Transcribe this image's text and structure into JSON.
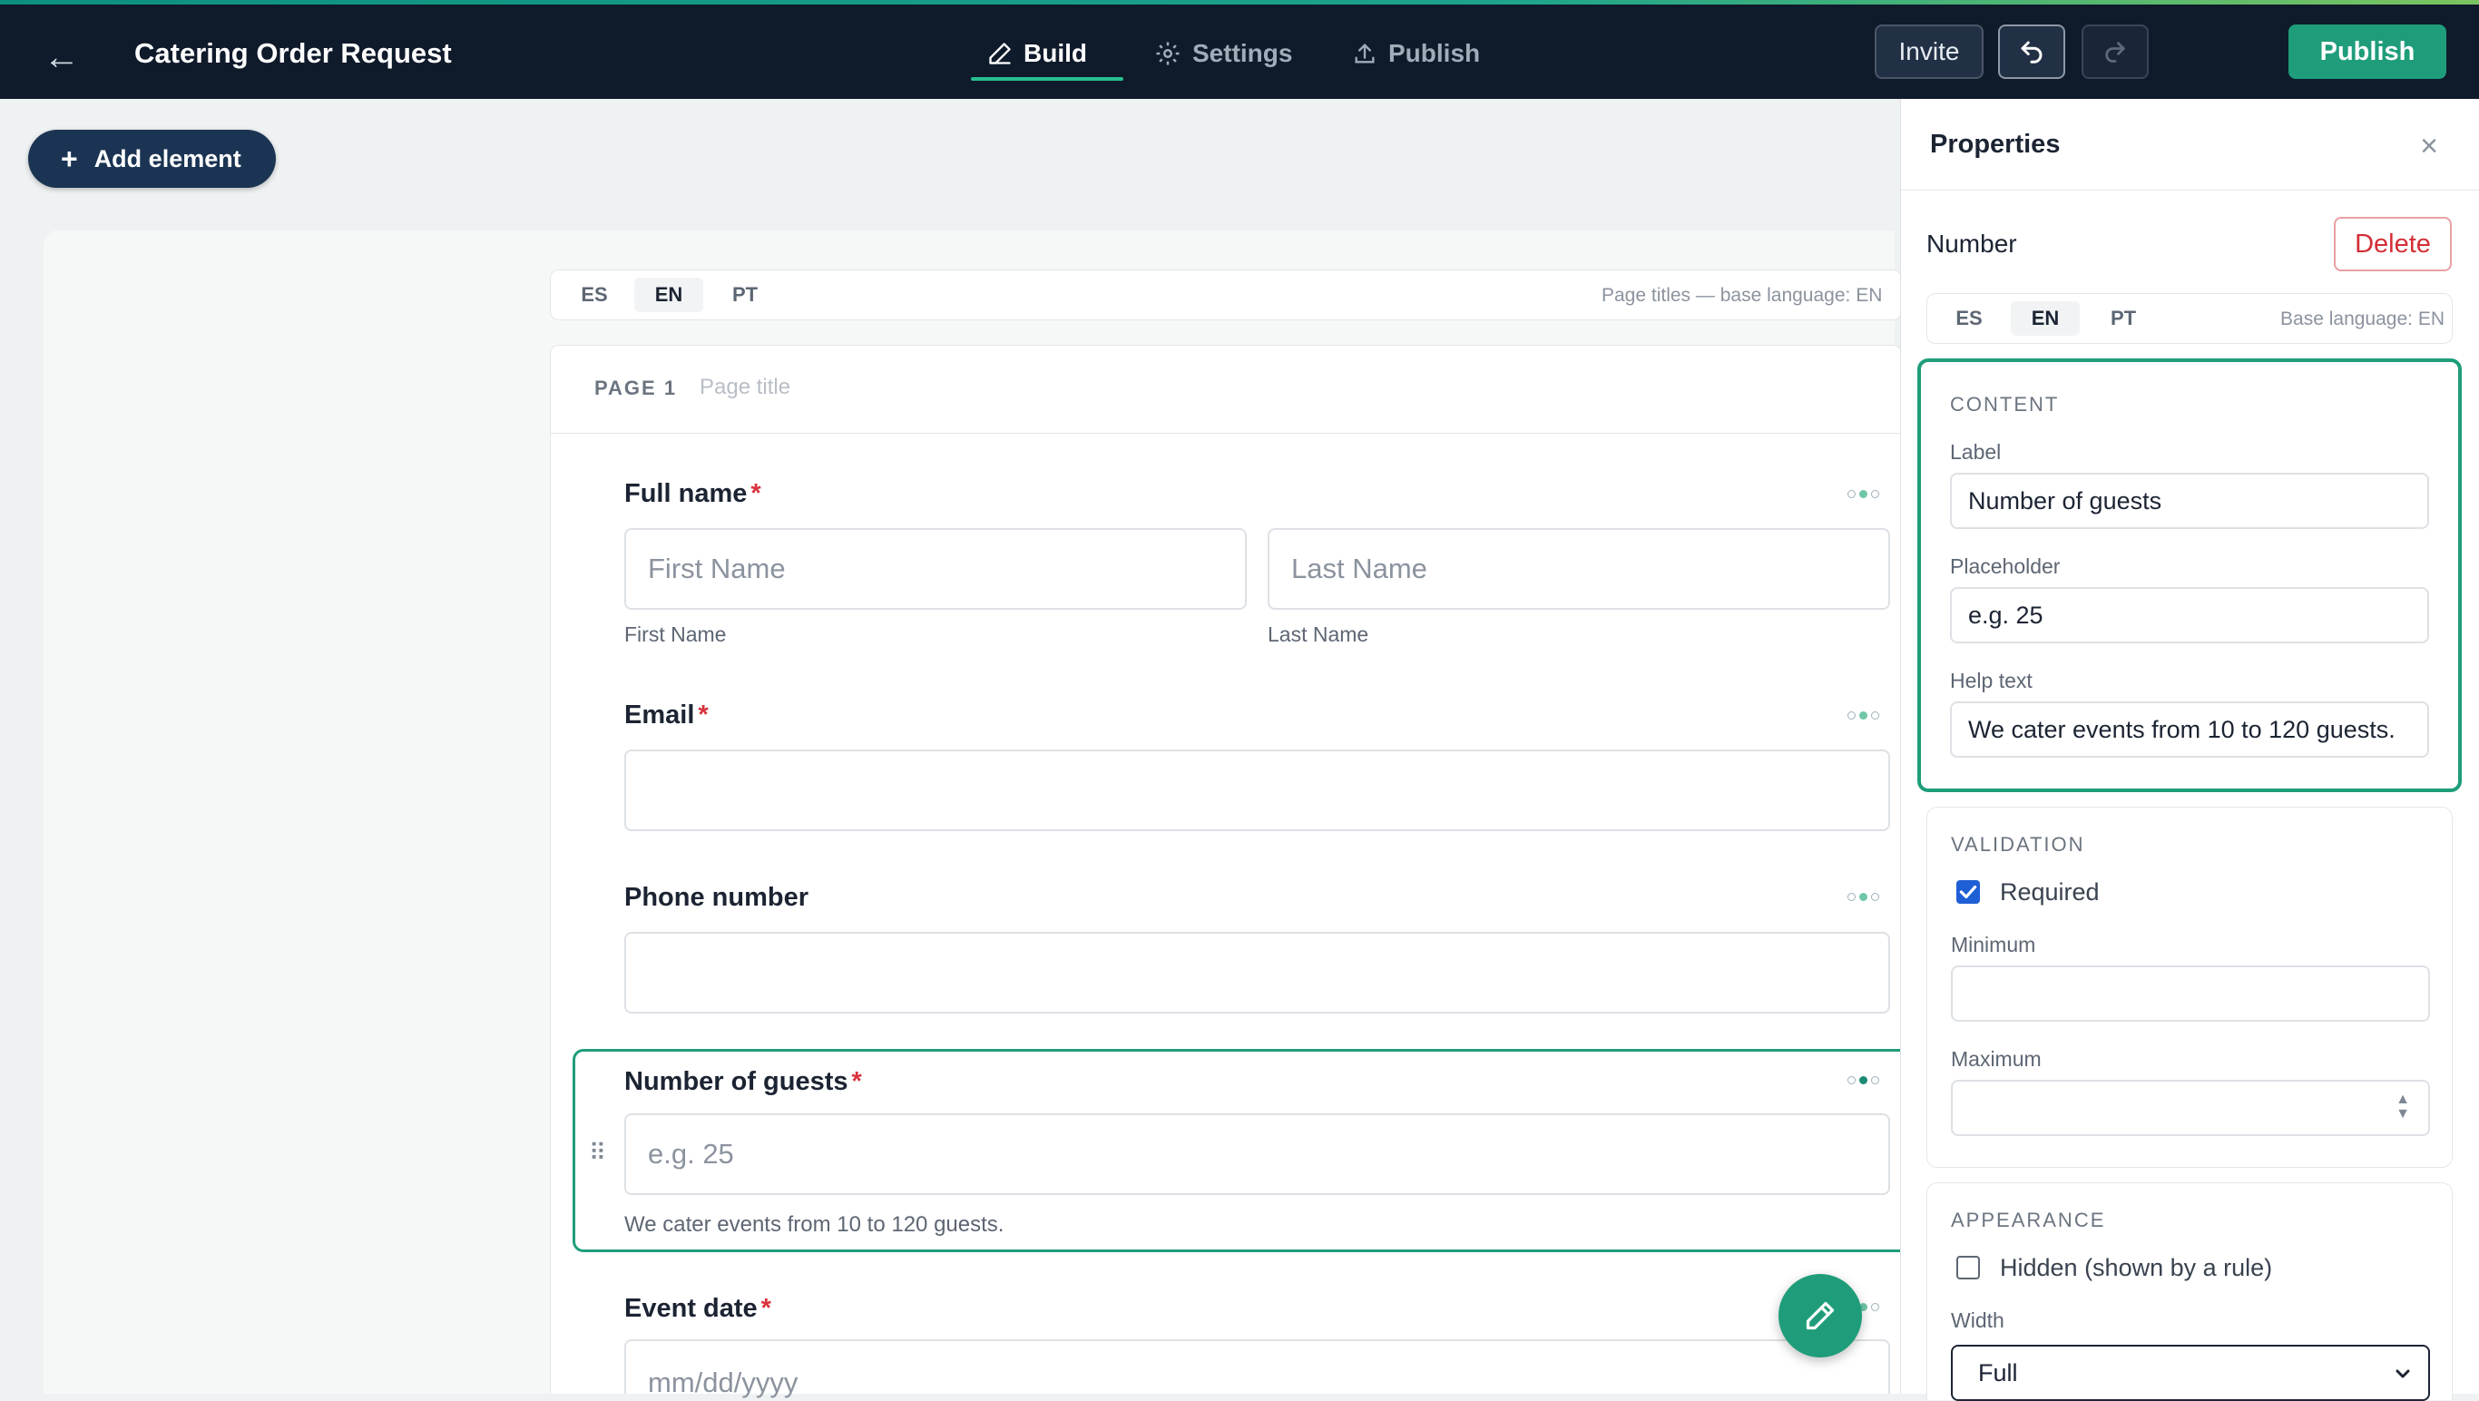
{
  "topbar": {
    "title": "Catering Order Request",
    "tabs": [
      {
        "label": "Build",
        "icon": "pencil-icon",
        "active": true
      },
      {
        "label": "Settings",
        "icon": "gear-icon",
        "active": false
      },
      {
        "label": "Publish",
        "icon": "upload-icon",
        "active": false
      }
    ],
    "invite_label": "Invite",
    "publish_label": "Publish"
  },
  "toolbar": {
    "add_element_label": "Add element"
  },
  "languages": [
    "ES",
    "EN",
    "PT"
  ],
  "canvas": {
    "language_hint": "Page titles — base language: EN",
    "page_number": "PAGE 1",
    "page_title_placeholder": "Page title"
  },
  "form": {
    "full_name": {
      "label": "Full name",
      "first_placeholder": "First Name",
      "last_placeholder": "Last Name",
      "first_sub": "First Name",
      "last_sub": "Last Name"
    },
    "email": {
      "label": "Email"
    },
    "phone": {
      "label": "Phone number"
    },
    "guests": {
      "label": "Number of guests",
      "placeholder": "e.g. 25",
      "help": "We cater events from 10 to 120 guests."
    },
    "event_date": {
      "label": "Event date",
      "placeholder": "mm/dd/yyyy"
    }
  },
  "properties": {
    "title": "Properties",
    "field_type": "Number",
    "delete_label": "Delete",
    "language_hint": "Base language: EN",
    "content": {
      "heading": "CONTENT",
      "label_label": "Label",
      "label_value": "Number of guests",
      "placeholder_label": "Placeholder",
      "placeholder_value": "e.g. 25",
      "help_label": "Help text",
      "help_value": "We cater events from 10 to 120 guests."
    },
    "validation": {
      "heading": "VALIDATION",
      "required_label": "Required",
      "required_checked": true,
      "minimum_label": "Minimum",
      "maximum_label": "Maximum"
    },
    "appearance": {
      "heading": "APPEARANCE",
      "hidden_label": "Hidden (shown by a rule)",
      "hidden_checked": false,
      "width_label": "Width",
      "width_value": "Full"
    }
  },
  "colors": {
    "accent": "#1f9d7b",
    "topbar": "#0f1a2b",
    "required": "#d8323c",
    "delete": "#d32f36"
  }
}
